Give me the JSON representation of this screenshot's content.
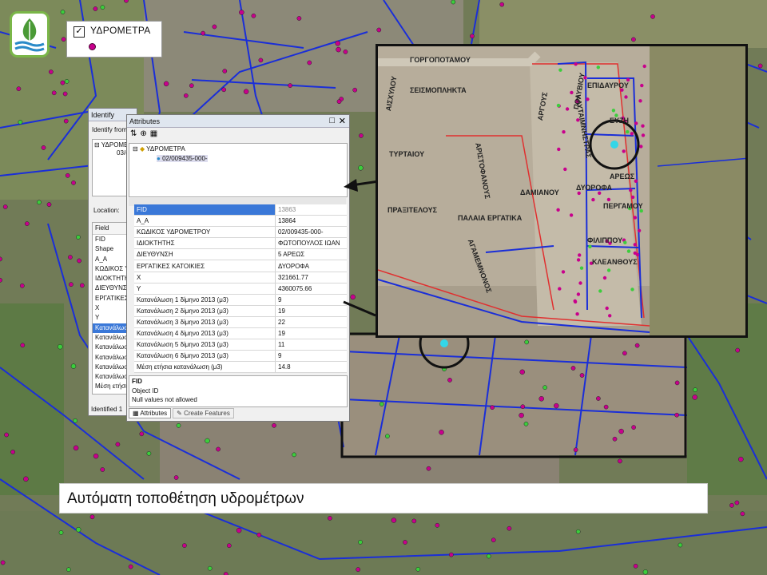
{
  "legend": {
    "layer_label": "ΥΔΡΟΜΕΤΡΑ",
    "checked": true,
    "symbol_color": "#c8008c"
  },
  "identify": {
    "title": "Identify",
    "identify_from": "Identify from",
    "tree_root": "ΥΔΡΟΜΕ",
    "tree_child": "03/(",
    "location_label": "Location:",
    "field_header": "Field",
    "fields": [
      "FID",
      "Shape",
      "A_A",
      "ΚΩΔΙΚΟΣ Υ",
      "ΙΔΙΟΚΤΗΤΗ",
      "ΔΙΕΥΘΥΝΣΗ",
      "ΕΡΓΑΤΙΚΕΣ",
      "X",
      "Y",
      "Κατανάλωσ",
      "Κατανάλωσ",
      "Κατανάλωσ",
      "Κατανάλωσ",
      "Κατανάλωσ",
      "Κατανάλωσ",
      "Μέση ετήσια"
    ],
    "selected_field_index": 9,
    "status": "Identified 1"
  },
  "attributes": {
    "title": "Attributes",
    "layer": "ΥΔΡΟΜΕΤΡΑ",
    "feature": "02/009435-000-",
    "rows": [
      [
        "FID",
        "13863"
      ],
      [
        "A_A",
        "13864"
      ],
      [
        "ΚΩΔΙΚΟΣ ΥΔΡΟΜΕΤΡΟΥ",
        "02/009435-000-"
      ],
      [
        "ΙΔΙΟΚΤΗΤΗΣ",
        "ΦΩΤΟΠΟΥΛΟΣ ΙΩΑΝ"
      ],
      [
        "ΔΙΕΥΘΥΝΣΗ",
        "5 ΑΡΕΩΣ"
      ],
      [
        "ΕΡΓΑΤΙΚΕΣ ΚΑΤΟΙΚΙΕΣ",
        "ΔΥΟΡΟΦΑ"
      ],
      [
        "X",
        "321661.77"
      ],
      [
        "Y",
        "4360075.66"
      ],
      [
        "Κατανάλωση 1 δίμηνο 2013 (μ3)",
        "9"
      ],
      [
        "Κατανάλωση 2 δίμηνο 2013 (μ3)",
        "19"
      ],
      [
        "Κατανάλωση 3 δίμηνο 2013 (μ3)",
        "22"
      ],
      [
        "Κατανάλωση 4 δίμηνο 2013 (μ3)",
        "19"
      ],
      [
        "Κατανάλωση 5 δίμηνο 2013 (μ3)",
        "11"
      ],
      [
        "Κατανάλωση 6 δίμηνο 2013 (μ3)",
        "9"
      ],
      [
        "Μέση ετήσια κατανάλωση (μ3)",
        "14.8"
      ]
    ],
    "desc_title": "FID",
    "desc_line1": "Object ID",
    "desc_line2": "Null values not allowed",
    "tab_attributes": "Attributes",
    "tab_create_features": "Create Features"
  },
  "inset": {
    "streets": [
      "ΓΟΡΓΟΠΟΤΑΜΟΥ",
      "ΣΕΙΣΜΟΠΛΗΚΤΑ",
      "ΑΙΣΧΥΛΟΥ",
      "ΑΡΓΟΥΣ",
      "ΠΟΛΥΒΙΟΥ",
      "ΑΡΙΣΤΟΦΑΝΟΥΣ",
      "ΤΥΡΤΑΙΟΥ",
      "ΔΑΜΙΑΝΟΥ",
      "ΠΡΑΞΙΤΕΛΟΥΣ",
      "ΠΑΛΑΙΑ ΕΡΓΑΤΙΚΑ",
      "ΑΓΑΜΕΜΝΟΝΟΣ",
      "ΕΠΙΔΑΥΡΟΥ",
      "ΚΛΥΤΑΙΜΝΗΣΤΡΑΣ",
      "ΕΥΖΗ",
      "ΑΡΕΩΣ",
      "ΔΥΟΡΟΦΑ",
      "ΠΕΡΓΑΜΟΥ",
      "ΦΙΛΙΠΠΟΥ",
      "ΚΛΕΑΝΘΟΥΣ"
    ]
  },
  "caption": {
    "text": "Αυτόματη τοποθέτηση υδρομέτρων"
  },
  "colors": {
    "pipe": "#1a2ed8",
    "meter": "#c8008c",
    "node": "#3ccd3c",
    "highlight": "#33d6e8",
    "parcel": "#e03030"
  }
}
